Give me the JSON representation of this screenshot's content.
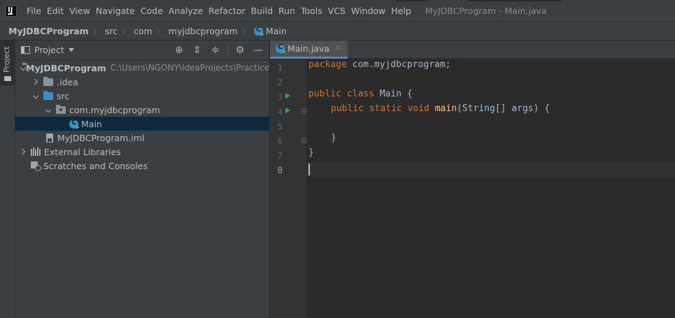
{
  "menubar": {
    "items": [
      "File",
      "Edit",
      "View",
      "Navigate",
      "Code",
      "Analyze",
      "Refactor",
      "Build",
      "Run",
      "Tools",
      "VCS",
      "Window",
      "Help"
    ],
    "window_title": "MyJDBCProgram - Main.java"
  },
  "breadcrumb": {
    "project": "MyJDBCProgram",
    "src": "src",
    "com": "com",
    "package": "myjdbcprogram",
    "file": "Main"
  },
  "toolstrip": {
    "project_tab": "Project"
  },
  "project_panel": {
    "title": "Project",
    "tree": {
      "root": {
        "name": "MyJDBCProgram",
        "path": "C:\\Users\\NGONY\\IdeaProjects\\Practice\\M"
      },
      "idea": ".idea",
      "src": "src",
      "package": "com.myjdbcprogram",
      "main_class": "Main",
      "iml": "MyJDBCProgram.iml",
      "external_libraries": "External Libraries",
      "scratches": "Scratches and Consoles"
    }
  },
  "editor": {
    "tab_label": "Main.java",
    "line_numbers": [
      "1",
      "2",
      "3",
      "4",
      "5",
      "6",
      "7",
      "8"
    ],
    "code": {
      "l1_kw": "package",
      "l1_rest": " com.myjdbcprogram;",
      "l3_kw": "public class",
      "l3_rest": " Main {",
      "l4_kw": "public static void",
      "l4_fn": "main",
      "l4_rest": "(String[] args) {",
      "l6": "}",
      "l7": "}"
    }
  },
  "colors": {
    "accent_tab": "#4a88c7",
    "keyword": "#cc7832",
    "function": "#ffc66d",
    "selection": "#0d293e",
    "run_gutter": "#499c54"
  }
}
